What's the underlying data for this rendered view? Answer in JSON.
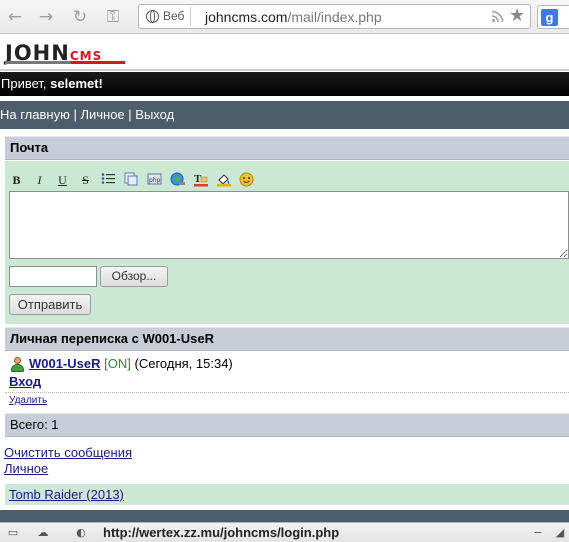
{
  "browser": {
    "omnibox_chip": "Веб",
    "url_host": "johncms.com",
    "url_path": "/mail/index.php",
    "search_logo": "g"
  },
  "site": {
    "logo_main": "JOHN",
    "logo_sub": "CMS",
    "greeting_prefix": "Привет, ",
    "greeting_user": "selemet!",
    "menu": {
      "home": "На главную",
      "sep1": " | ",
      "personal": "Личное",
      "sep2": " | ",
      "logout": "Выход"
    }
  },
  "mail": {
    "header": "Почта",
    "format_buttons": [
      "B",
      "I",
      "U",
      "S"
    ],
    "browse_label": "Обзор...",
    "send_label": "Отправить",
    "file_value": "",
    "message_value": ""
  },
  "conversation": {
    "header": "Личная переписка с W001-UseR",
    "user": "W001-UseR",
    "status": "[ON]",
    "time": "(Сегодня, 15:34)",
    "direction": "Вход",
    "delete": "Удалить",
    "total": "Всего: 1"
  },
  "footer": {
    "clear_messages": "Очистить сообщения",
    "personal": "Личное",
    "ad_link": "Tomb Raider (2013)"
  },
  "statusbar": {
    "url": "http://wertex.zz.mu/johncms/login.php"
  },
  "colors": {
    "section_header": "#c7ccd6",
    "panel_green": "#cbe8d4",
    "menu_bar": "#4d5d6b",
    "logo_red": "#d21c1c"
  }
}
